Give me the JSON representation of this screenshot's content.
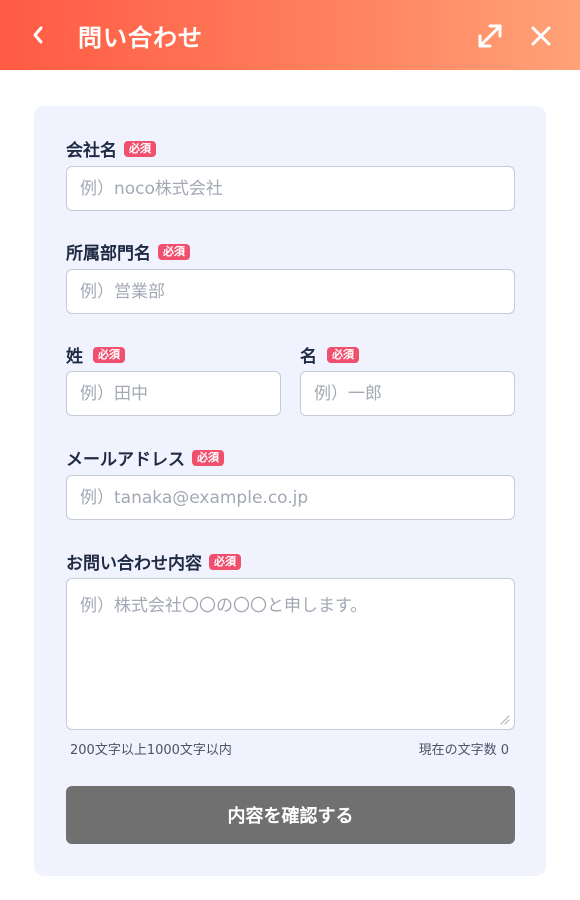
{
  "header": {
    "title": "問い合わせ",
    "back_icon": "chevron-left-icon",
    "expand_icon": "expand-icon",
    "close_icon": "close-icon",
    "gradient": [
      "#ff5a44",
      "#ffa277"
    ]
  },
  "form": {
    "required_badge": "必須",
    "company": {
      "label": "会社名",
      "placeholder": "例）noco株式会社",
      "value": ""
    },
    "department": {
      "label": "所属部門名",
      "placeholder": "例）営業部",
      "value": ""
    },
    "last_name": {
      "label": "姓",
      "placeholder": "例）田中",
      "value": ""
    },
    "first_name": {
      "label": "名",
      "placeholder": "例）一郎",
      "value": ""
    },
    "email": {
      "label": "メールアドレス",
      "placeholder": "例）tanaka@example.co.jp",
      "value": ""
    },
    "message": {
      "label": "お問い合わせ内容",
      "placeholder": "例）株式会社〇〇の〇〇と申します。",
      "value": "",
      "length_hint": "200文字以上1000文字以内",
      "char_count": "現在の文字数 0"
    },
    "submit_label": "内容を確認する"
  },
  "colors": {
    "card_bg": "#f0f3fd",
    "badge": "#f0506e",
    "submit_disabled": "#707070"
  }
}
